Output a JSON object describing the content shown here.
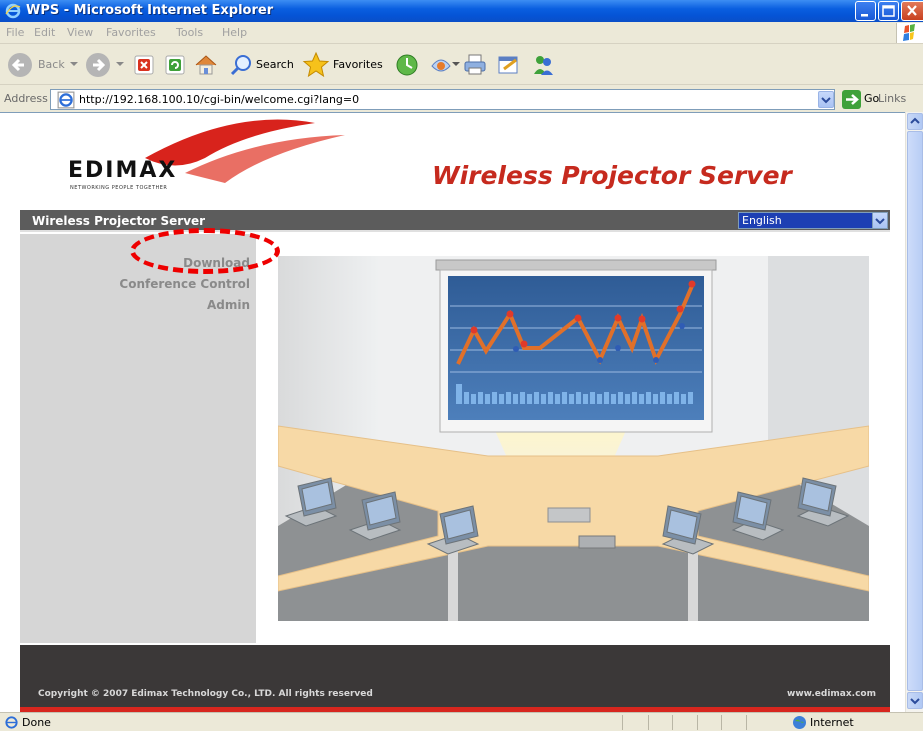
{
  "window": {
    "title": "WPS - Microsoft Internet Explorer"
  },
  "menu": [
    "File",
    "Edit",
    "View",
    "Favorites",
    "Tools",
    "Help"
  ],
  "toolbar": {
    "back_label": "Back",
    "search_label": "Search",
    "favorites_label": "Favorites"
  },
  "address": {
    "label": "Address",
    "url": "http://192.168.100.10/cgi-bin/welcome.cgi?lang=0",
    "go_label": "Go",
    "links_label": "Links"
  },
  "page": {
    "logo_text": "EDIMAX",
    "logo_tagline": "NETWORKING PEOPLE TOGETHER",
    "headline": "Wireless Projector Server",
    "nav_title": "Wireless Projector Server",
    "language_selected": "English",
    "side_links": [
      "Download",
      "Conference Control",
      "Admin"
    ],
    "footer_copyright": "Copyright © 2007 Edimax Technology Co., LTD. All rights reserved",
    "footer_url": "www.edimax.com"
  },
  "status": {
    "text": "Done",
    "zone": "Internet"
  },
  "colors": {
    "brand_red": "#c62a1e",
    "nav_gray": "#5c5c5c",
    "highlight_red": "#e00000"
  }
}
